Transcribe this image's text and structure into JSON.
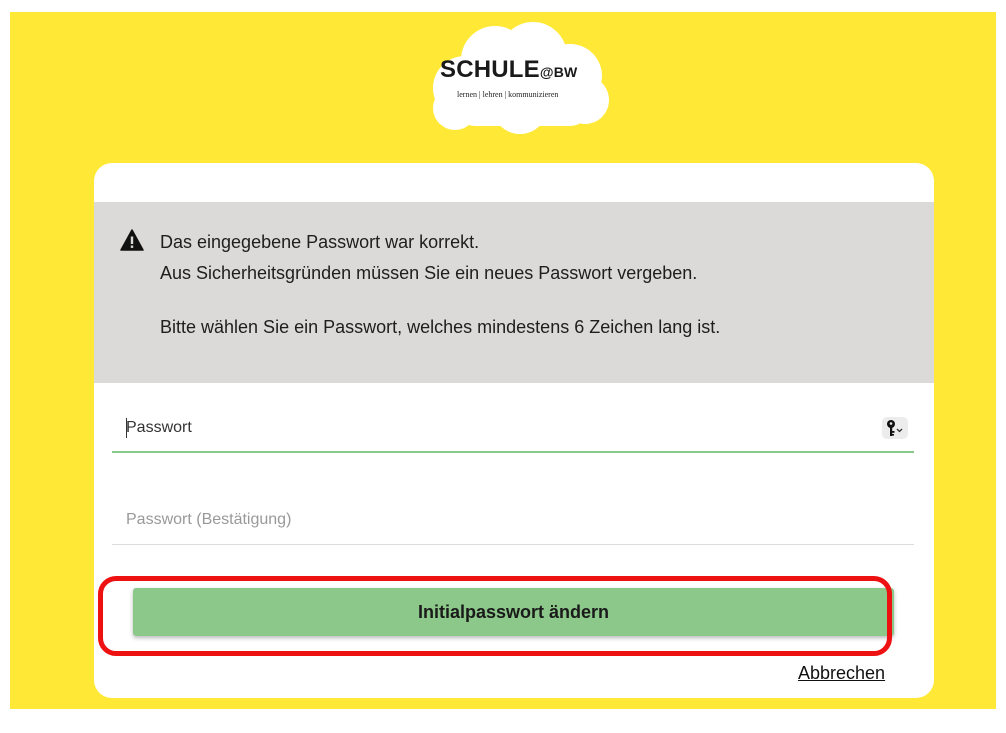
{
  "logo": {
    "title": "SCHULE",
    "suffix": "@BW",
    "tagline": "lernen | lehren | kommunizieren"
  },
  "alert": {
    "icon": "warning-icon",
    "line1": "Das eingegebene Passwort war korrekt.",
    "line2": "Aus Sicherheitsgründen müssen Sie ein neues Passwort vergeben.",
    "line3": "Bitte wählen Sie ein Passwort, welches mindestens 6 Zeichen lang ist."
  },
  "form": {
    "password": {
      "placeholder": "Passwort",
      "value": "",
      "icon": "key-icon"
    },
    "password_confirm": {
      "placeholder": "Passwort (Bestätigung)",
      "value": ""
    },
    "submit_label": "Initialpasswort ändern",
    "cancel_label": "Abbrechen"
  },
  "colors": {
    "background": "#ffe936",
    "alert_bg": "#dcdad8",
    "button": "#8cc88a",
    "focus_underline": "#8ac78a",
    "highlight": "#ee1111"
  }
}
